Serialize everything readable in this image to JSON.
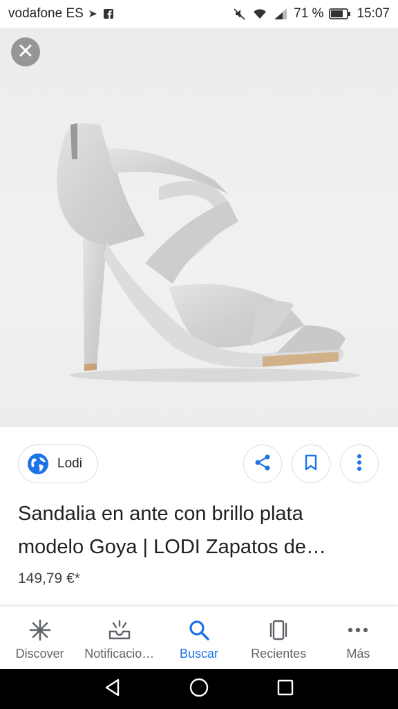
{
  "status_bar": {
    "carrier": "vodafone ES",
    "battery_percent": "71 %",
    "time": "15:07"
  },
  "image_viewer": {
    "close_icon": "close-icon",
    "image_subject": "silver-sandal"
  },
  "source": {
    "name": "Lodi",
    "icon": "globe-icon"
  },
  "actions": {
    "share_icon": "share-icon",
    "bookmark_icon": "bookmark-icon",
    "more_icon": "more-vert-icon"
  },
  "result": {
    "title_line1": "Sandalia en ante con brillo plata",
    "title_line2": "modelo Goya | LODI Zapatos de…",
    "price": "149,79 €*"
  },
  "bottom_nav": {
    "items": [
      {
        "label": "Discover",
        "icon": "asterisk-icon"
      },
      {
        "label": "Notificacio…",
        "icon": "tray-icon"
      },
      {
        "label": "Buscar",
        "icon": "search-icon"
      },
      {
        "label": "Recientes",
        "icon": "recents-icon"
      },
      {
        "label": "Más",
        "icon": "more-horiz-icon"
      }
    ],
    "active_index": 2
  },
  "colors": {
    "accent": "#1a73e8",
    "text_primary": "#202124",
    "text_secondary": "#5f6368"
  }
}
